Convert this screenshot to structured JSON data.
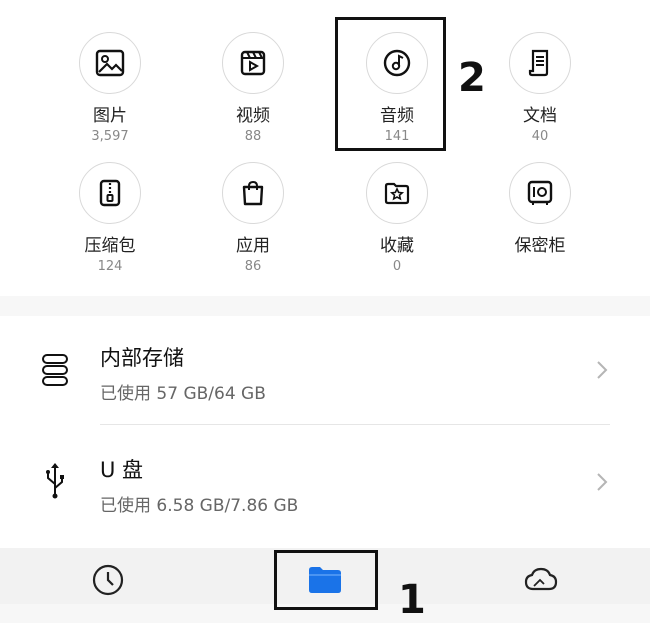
{
  "categories": [
    {
      "label": "图片",
      "count": "3,597",
      "icon": "image-icon"
    },
    {
      "label": "视频",
      "count": "88",
      "icon": "video-icon"
    },
    {
      "label": "音频",
      "count": "141",
      "icon": "music-disc-icon"
    },
    {
      "label": "文档",
      "count": "40",
      "icon": "document-icon"
    },
    {
      "label": "压缩包",
      "count": "124",
      "icon": "zip-icon"
    },
    {
      "label": "应用",
      "count": "86",
      "icon": "app-bag-icon"
    },
    {
      "label": "收藏",
      "count": "0",
      "icon": "star-folder-icon"
    },
    {
      "label": "保密柜",
      "count": "",
      "icon": "safe-icon"
    }
  ],
  "storage": [
    {
      "title": "内部存储",
      "usage": "已使用 57 GB/64 GB",
      "icon": "storage-icon"
    },
    {
      "title": "U 盘",
      "usage": "已使用 6.58 GB/7.86 GB",
      "icon": "usb-icon"
    }
  ],
  "bottom_nav": [
    {
      "icon": "recent-clock-icon"
    },
    {
      "icon": "folder-icon",
      "active": true,
      "color": "#1a73e8"
    },
    {
      "icon": "cloud-icon"
    }
  ],
  "annotations": {
    "one": "1",
    "two": "2"
  }
}
